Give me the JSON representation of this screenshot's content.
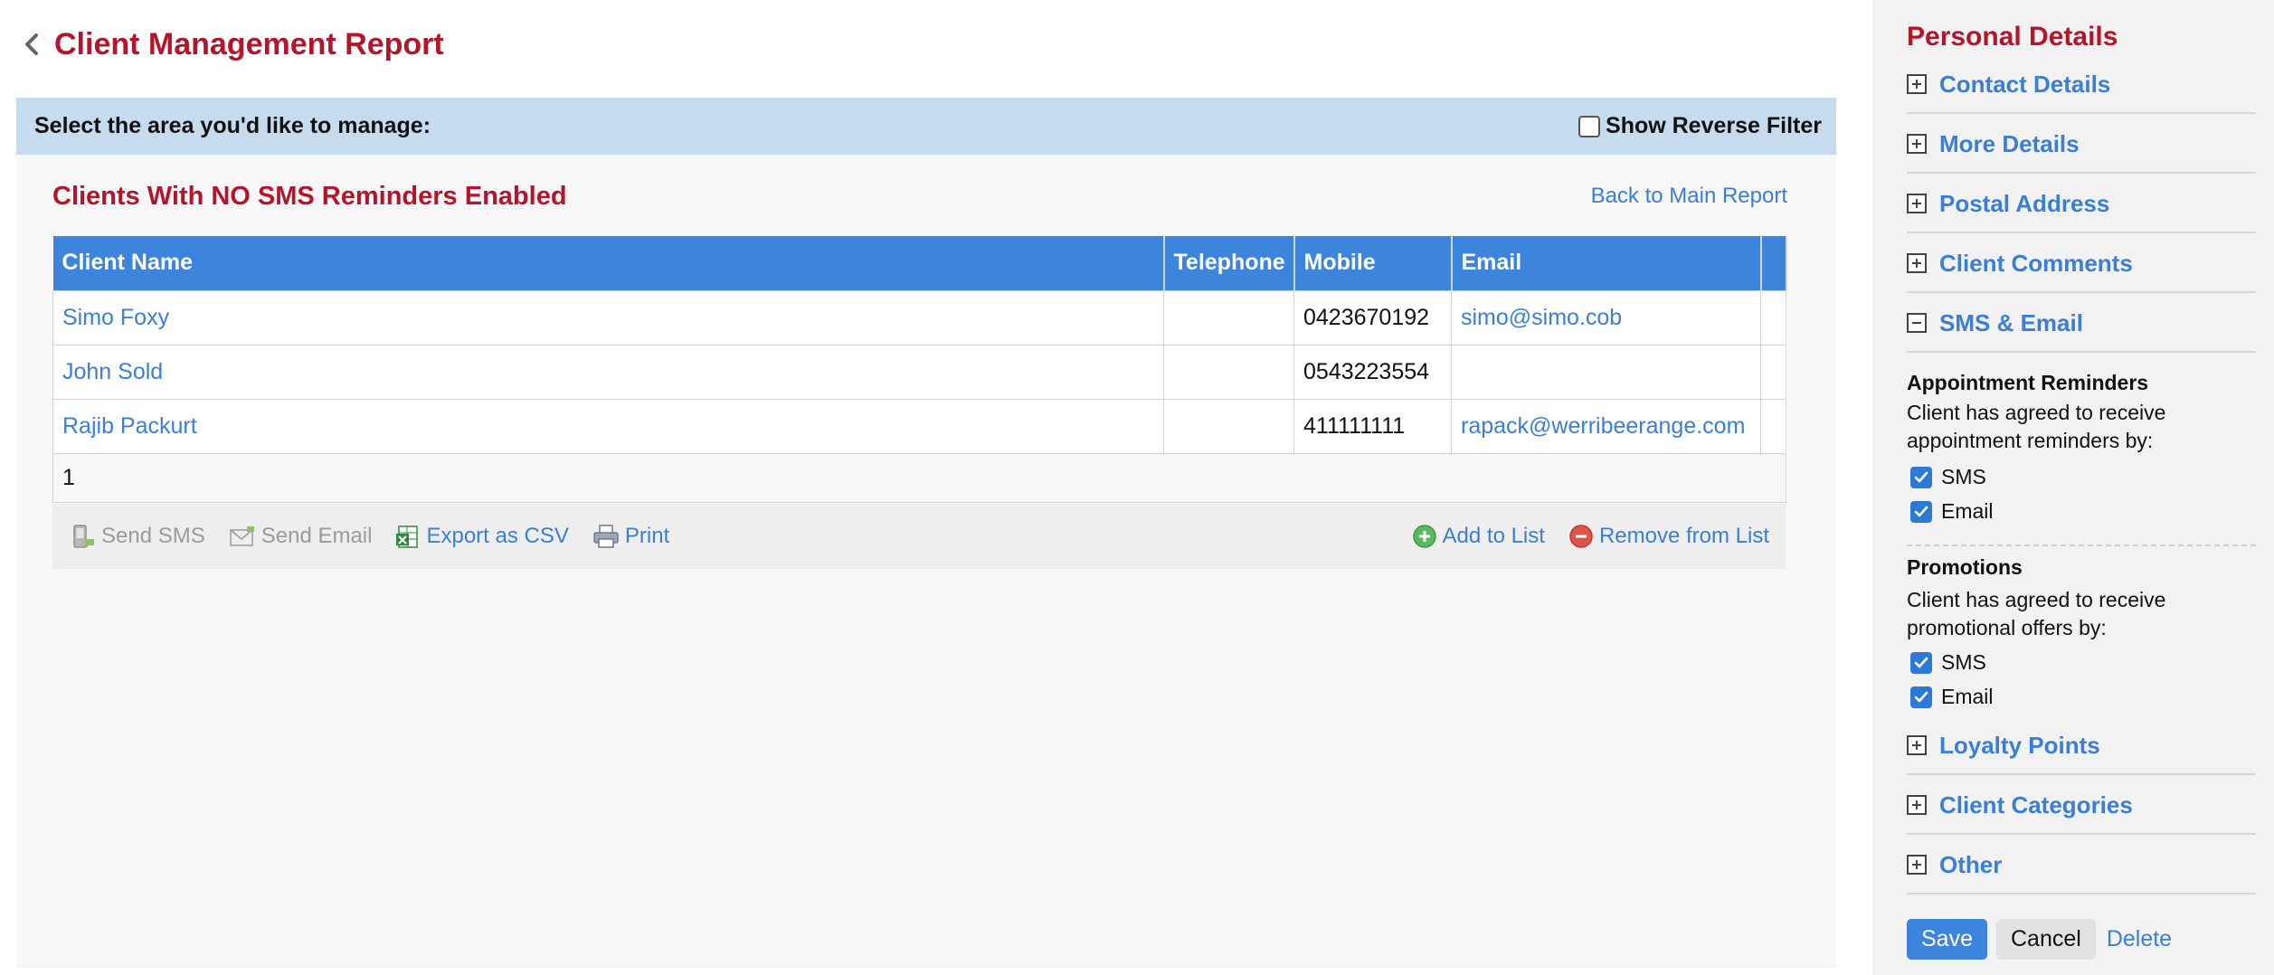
{
  "header": {
    "title": "Client Management Report"
  },
  "filter": {
    "prompt": "Select the area you'd like to manage:",
    "reverse_filter_label": "Show Reverse Filter",
    "reverse_filter_checked": false
  },
  "report": {
    "heading": "Clients With NO SMS Reminders Enabled",
    "back_link": "Back to Main Report",
    "columns": [
      "Client Name",
      "Telephone",
      "Mobile",
      "Email"
    ],
    "rows": [
      {
        "name": "Simo Foxy",
        "telephone": "",
        "mobile": "0423670192",
        "email": "simo@simo.cob"
      },
      {
        "name": "John Sold",
        "telephone": "",
        "mobile": "0543223554",
        "email": ""
      },
      {
        "name": "Rajib Packurt",
        "telephone": "",
        "mobile": "411111111",
        "email": "rapack@werribeerange.com"
      }
    ],
    "page": "1"
  },
  "actions": {
    "send_sms": "Send SMS",
    "send_email": "Send Email",
    "export_csv": "Export as CSV",
    "print": "Print",
    "add_to_list": "Add to List",
    "remove_from_list": "Remove from List"
  },
  "sidebar": {
    "title": "Personal Details",
    "sections_top": [
      {
        "label": "Contact Details",
        "state": "collapsed"
      },
      {
        "label": "More Details",
        "state": "collapsed"
      },
      {
        "label": "Postal Address",
        "state": "collapsed"
      },
      {
        "label": "Client Comments",
        "state": "collapsed"
      },
      {
        "label": "SMS & Email",
        "state": "expanded"
      }
    ],
    "appointment": {
      "title": "Appointment Reminders",
      "text": "Client has agreed to receive appointment reminders by:",
      "sms": "SMS",
      "email": "Email"
    },
    "promotions": {
      "title": "Promotions",
      "text": "Client has agreed to receive promotional offers by:",
      "sms": "SMS",
      "email": "Email"
    },
    "sections_bottom": [
      {
        "label": "Loyalty Points",
        "state": "collapsed"
      },
      {
        "label": "Client Categories",
        "state": "collapsed"
      },
      {
        "label": "Other",
        "state": "collapsed"
      }
    ],
    "buttons": {
      "save": "Save",
      "cancel": "Cancel",
      "delete": "Delete"
    }
  },
  "colors": {
    "accent_red": "#b5152b",
    "header_blue": "#3d84dd",
    "link_blue": "#3a7fd5",
    "filter_bar": "#c6dcee"
  },
  "icons": {
    "back": "chevron-left-icon",
    "expand": "plus-box-icon",
    "collapse": "minus-box-icon",
    "send_sms": "sms-phone-icon",
    "send_email": "envelope-icon",
    "export_csv": "spreadsheet-icon",
    "print": "printer-icon",
    "add_to_list": "plus-circle-icon",
    "remove_from_list": "minus-circle-icon"
  }
}
